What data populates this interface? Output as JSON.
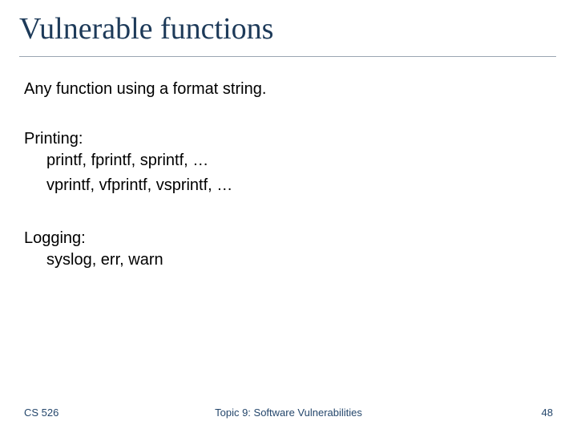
{
  "title": "Vulnerable functions",
  "intro": "Any function using a format string.",
  "section1": {
    "heading": "Printing:",
    "line1": "printf, fprintf, sprintf, …",
    "line2": "vprintf, vfprintf, vsprintf, …"
  },
  "section2": {
    "heading": "Logging:",
    "line1": "syslog,  err, warn"
  },
  "footer": {
    "left": "CS 526",
    "center": "Topic 9: Software Vulnerabilities",
    "right": "48"
  }
}
